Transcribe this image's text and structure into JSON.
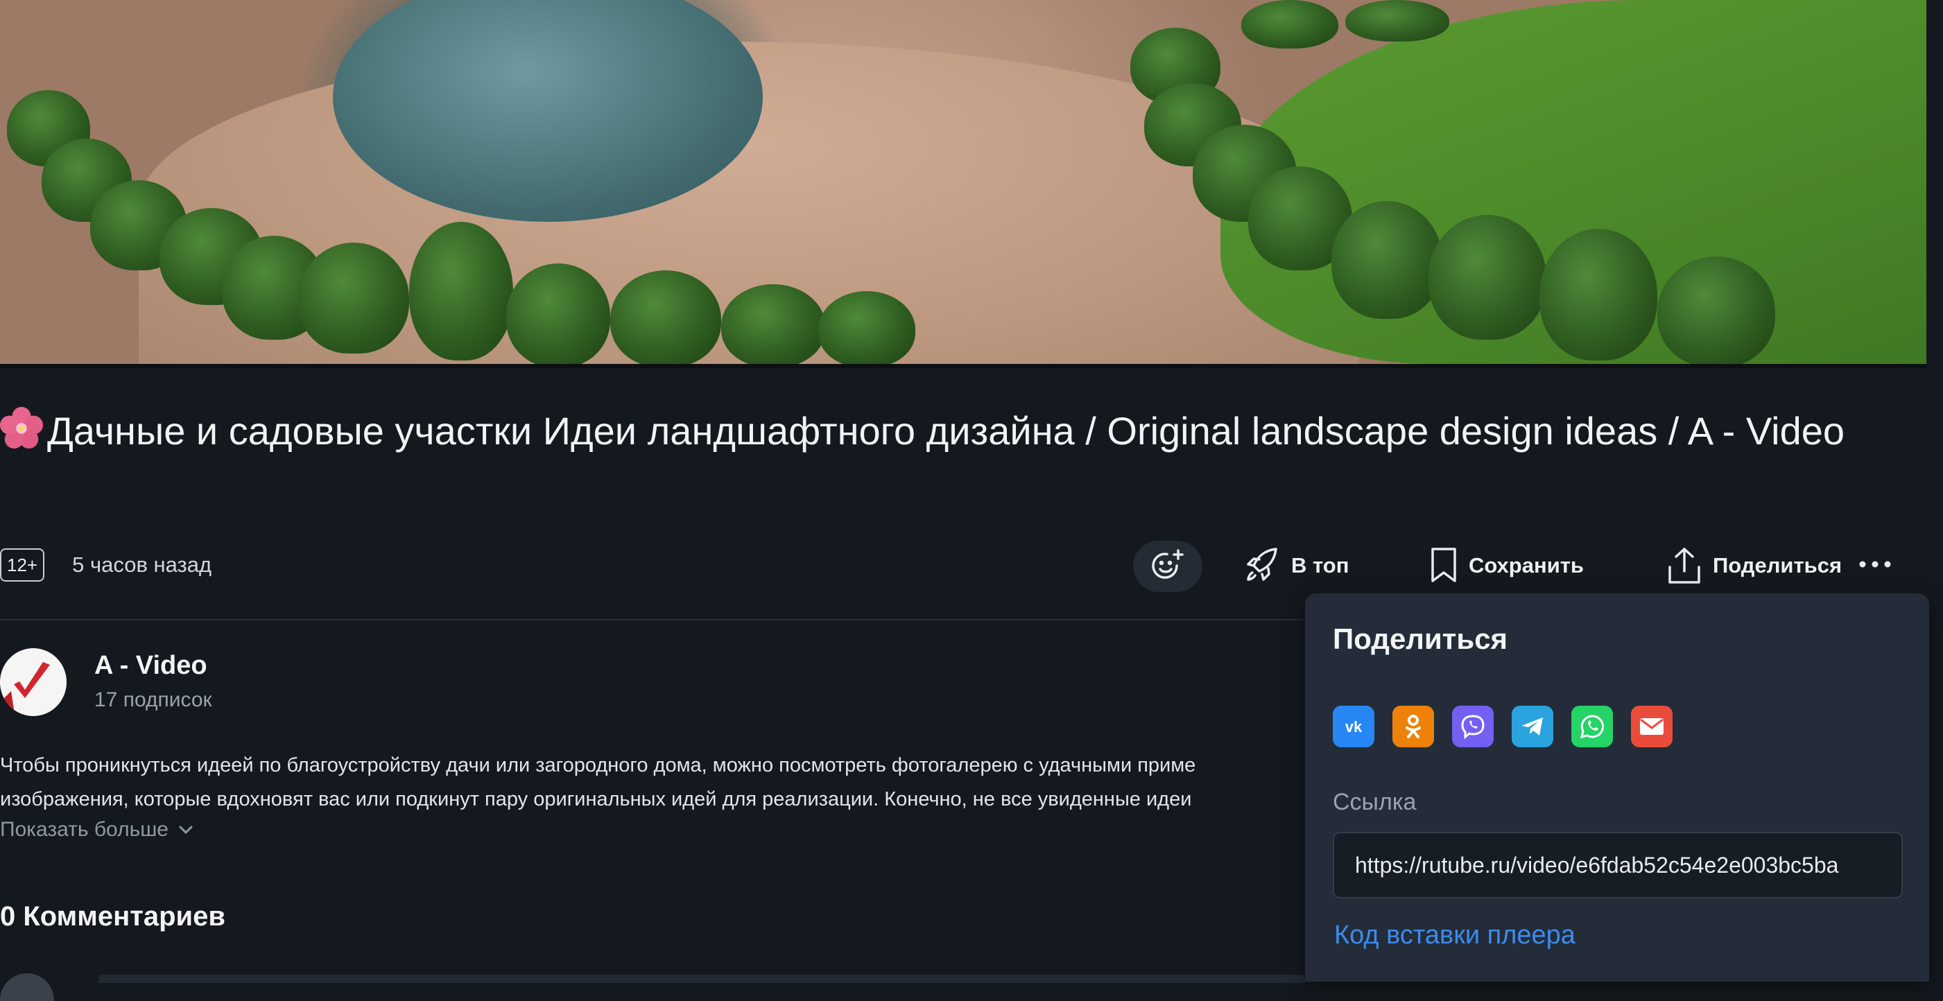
{
  "video": {
    "title_emoji": "hibiscus",
    "title": "Дачные и садовые участки Идеи ландшафтного дизайна / Original landscape design ideas / A - Video",
    "age_rating": "12+",
    "published": "5 часов назад"
  },
  "actions": {
    "reaction_icon": "emoji-add-icon",
    "top_label": "В топ",
    "save_label": "Сохранить",
    "share_label": "Поделиться",
    "more_icon": "more-horizontal-icon"
  },
  "channel": {
    "name": "A - Video",
    "subscribers": "17 подписок"
  },
  "description": {
    "line1": "Чтобы проникнуться идеей по благоустройству дачи или загородного дома, можно посмотреть фотогалерею с удачными приме",
    "line2": "изображения, которые вдохновят вас или подкинут пару оригинальных идей для реализации. Конечно, не все увиденные идеи",
    "show_more": "Показать больше"
  },
  "comments": {
    "heading": "0 Комментариев"
  },
  "share_popup": {
    "title": "Поделиться",
    "services": [
      {
        "name": "vk",
        "color": "#2787f5"
      },
      {
        "name": "odnoklassniki",
        "color": "#ee8208"
      },
      {
        "name": "viber",
        "color": "#7360f2"
      },
      {
        "name": "telegram",
        "color": "#2aa3df"
      },
      {
        "name": "whatsapp",
        "color": "#25d366"
      },
      {
        "name": "email",
        "color": "#ea4c3b"
      }
    ],
    "link_label": "Ссылка",
    "link_value": "https://rutube.ru/video/e6fdab52c54e2e003bc5ba",
    "embed_label": "Код вставки плеера"
  },
  "colors": {
    "background": "#14191f",
    "popup": "#232c38",
    "accent_link": "#3d8bef"
  }
}
